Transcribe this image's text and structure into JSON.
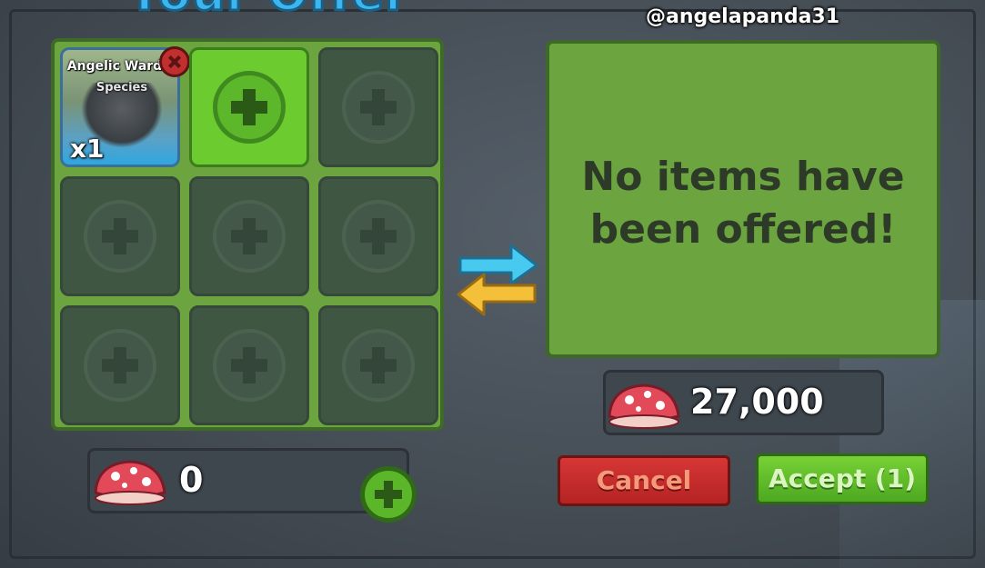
{
  "header": {
    "title": "Your Offer",
    "watermark": "@angelapanda31"
  },
  "your_offer": {
    "item": {
      "name": "Angelic Ward",
      "subtitle": "Species",
      "quantity": "x1"
    },
    "currency_amount": "0"
  },
  "their_offer": {
    "empty_message_line1": "No items have",
    "empty_message_line2": "been offered!",
    "currency_amount": "27,000"
  },
  "buttons": {
    "cancel": "Cancel",
    "accept": "Accept (1)"
  },
  "icons": {
    "currency": "mushroom-icon",
    "swap": "swap-arrows-icon",
    "add": "plus-icon",
    "remove": "close-icon"
  },
  "colors": {
    "panel_green": "#6ca540",
    "accept_green": "#5bb62a",
    "cancel_red": "#c22f2f",
    "arrow_blue": "#48c9f0",
    "arrow_yellow": "#f4c03a"
  }
}
